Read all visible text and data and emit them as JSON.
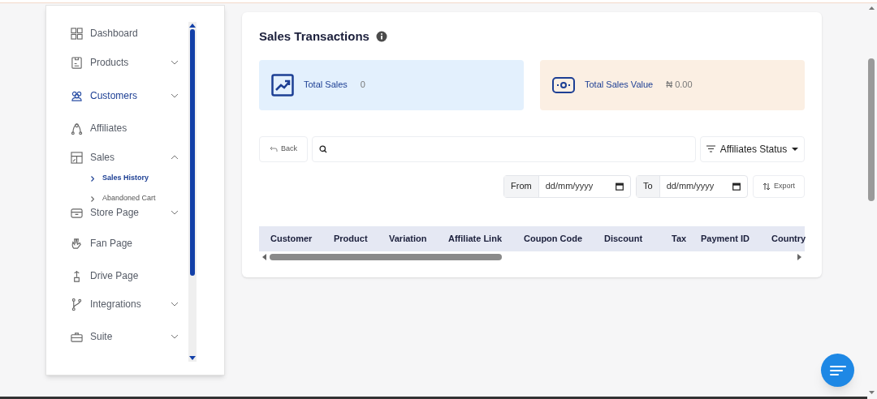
{
  "sidebar": {
    "items": [
      {
        "label": "Dashboard",
        "kind": "link",
        "selected": false
      },
      {
        "label": "Products",
        "kind": "group",
        "selected": false,
        "expanded": false
      },
      {
        "label": "Customers",
        "kind": "group",
        "selected": true,
        "expanded": false
      },
      {
        "label": "Affiliates",
        "kind": "link",
        "selected": false
      },
      {
        "label": "Sales",
        "kind": "group",
        "selected": false,
        "expanded": true,
        "children": [
          {
            "label": "Sales History",
            "selected": true
          },
          {
            "label": "Abandoned Cart",
            "selected": false
          }
        ]
      },
      {
        "label": "Store Page",
        "kind": "group",
        "selected": false,
        "expanded": false
      },
      {
        "label": "Fan Page",
        "kind": "link",
        "selected": false
      },
      {
        "label": "Drive Page",
        "kind": "link",
        "selected": false
      },
      {
        "label": "Integrations",
        "kind": "group",
        "selected": false,
        "expanded": false
      },
      {
        "label": "Suite",
        "kind": "group",
        "selected": false,
        "expanded": false
      }
    ]
  },
  "main": {
    "title": "Sales Transactions",
    "stats": [
      {
        "label": "Total Sales",
        "value": "0",
        "color": "#e3f0fd"
      },
      {
        "label": "Total Sales Value",
        "value": "₦ 0.00",
        "color": "#fbefe3"
      }
    ],
    "back": "Back",
    "filter": "Affiliates Status",
    "from": {
      "label": "From",
      "placeholder": "dd/mm/yyyy"
    },
    "to": {
      "label": "To",
      "placeholder": "dd/mm/yyyy"
    },
    "export": "Export",
    "table": {
      "columns": [
        "Customer",
        "Product",
        "Variation",
        "Affiliate Link",
        "Coupon Code",
        "Discount",
        "Tax",
        "Payment ID",
        "Country"
      ]
    }
  }
}
